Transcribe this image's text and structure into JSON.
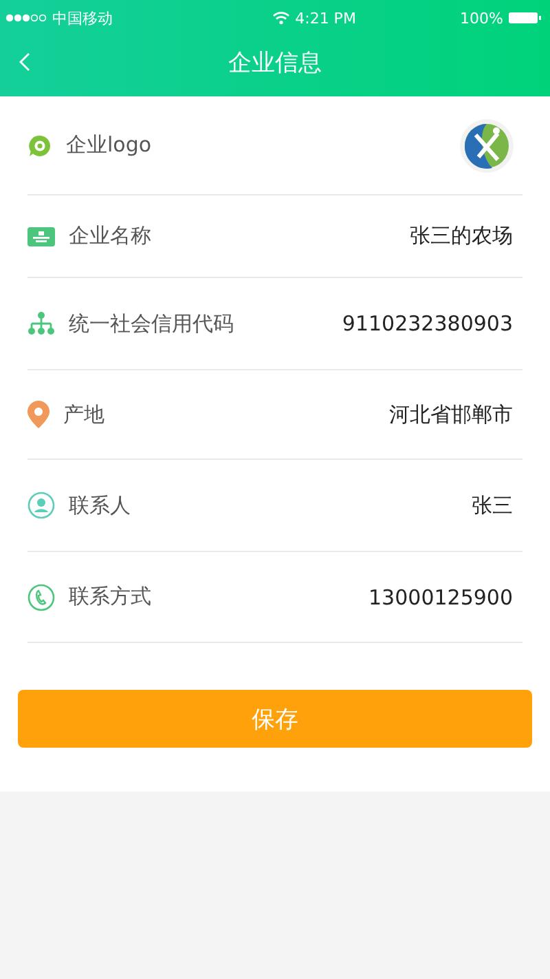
{
  "status_bar": {
    "carrier": "中国移动",
    "time": "4:21 PM",
    "battery_text": "100%"
  },
  "nav": {
    "title": "企业信息"
  },
  "rows": [
    {
      "kind": "logo",
      "label": "企业logo"
    },
    {
      "kind": "text",
      "label": "企业名称",
      "value": "张三的农场"
    },
    {
      "kind": "text",
      "label": "统一社会信用代码",
      "value": "9110232380903"
    },
    {
      "kind": "text",
      "label": "产地",
      "value": "河北省邯郸市"
    },
    {
      "kind": "text",
      "label": "联系人",
      "value": "张三"
    },
    {
      "kind": "text",
      "label": "联系方式",
      "value": "13000125900"
    }
  ],
  "save_button": "保存"
}
